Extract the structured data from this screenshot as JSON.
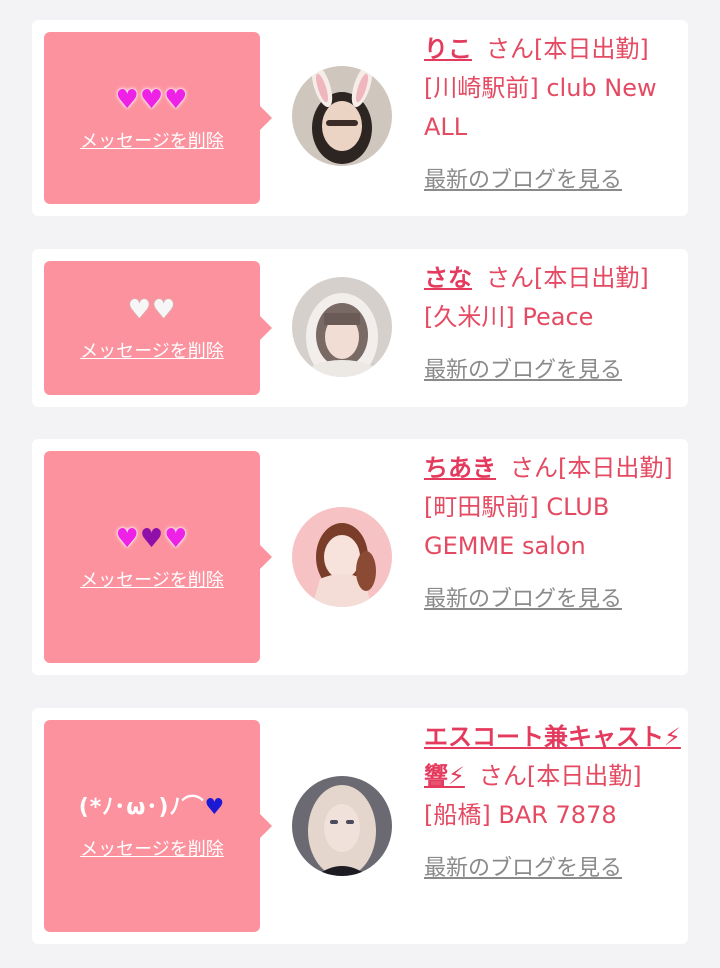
{
  "delete_label": "メッセージを削除",
  "blog_label": "最新のブログを見る",
  "cards": [
    {
      "message_icons": [
        "pink-heart",
        "pink-heart",
        "pink-heart"
      ],
      "name": "りこ",
      "status": "さん[本日出勤]",
      "location": "[川崎駅前] club New ALL"
    },
    {
      "message_icons": [
        "white-heart",
        "white-heart"
      ],
      "name": "さな",
      "status": "さん[本日出勤]",
      "location": "[久米川] Peace"
    },
    {
      "message_icons": [
        "pink-heart",
        "purple-heart",
        "pink-heart"
      ],
      "name": "ちあき",
      "status": "さん[本日出勤]",
      "location": "[町田駅前] CLUB GEMME salon"
    },
    {
      "message_text": "(*ﾉ･ω･)ﾉ⌒",
      "message_icons": [
        "blue-heart"
      ],
      "name": "エスコート兼キャスト⚡響⚡",
      "status": "さん[本日出勤]",
      "location": "[船橋] BAR 7878"
    }
  ],
  "colors": {
    "bubble": "#fc929e",
    "name": "#e43a5e",
    "text": "#e44a62",
    "link_gray": "#8a8a8a"
  }
}
